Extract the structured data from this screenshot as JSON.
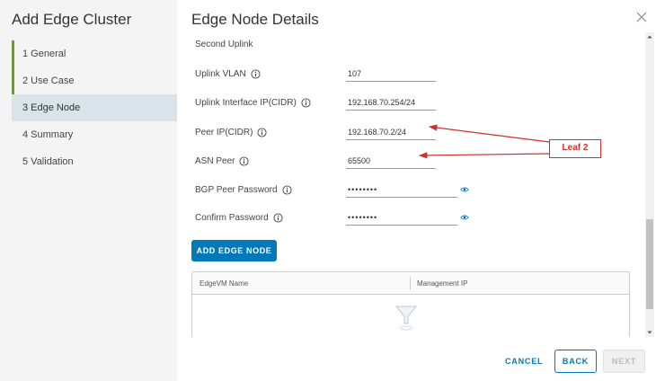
{
  "wizard": {
    "title": "Add Edge Cluster",
    "steps": [
      {
        "label": "1  General",
        "state": "done"
      },
      {
        "label": "2  Use Case",
        "state": "done"
      },
      {
        "label": "3  Edge Node",
        "state": "active"
      },
      {
        "label": "4  Summary",
        "state": "pending"
      },
      {
        "label": "5  Validation",
        "state": "pending"
      }
    ]
  },
  "main": {
    "title": "Edge Node Details",
    "section": "Second Uplink",
    "fields": {
      "uplink_vlan": {
        "label": "Uplink VLAN",
        "value": "107"
      },
      "uplink_ip": {
        "label": "Uplink Interface IP(CIDR)",
        "value": "192.168.70.254/24"
      },
      "peer_ip": {
        "label": "Peer IP(CIDR)",
        "value": "192.168.70.2/24"
      },
      "asn_peer": {
        "label": "ASN Peer",
        "value": "65500"
      },
      "bgp_password": {
        "label": "BGP Peer Password",
        "value": "••••••••"
      },
      "confirm_password": {
        "label": "Confirm Password",
        "value": "••••••••"
      }
    },
    "add_button": "ADD EDGE NODE",
    "grid": {
      "columns": [
        "EdgeVM Name",
        "Management IP"
      ]
    }
  },
  "footer": {
    "cancel": "CANCEL",
    "back": "BACK",
    "next": "NEXT"
  },
  "annotation": {
    "callout_text": "Leaf 2",
    "color": "#d0302b"
  },
  "colors": {
    "accent": "#0079b8",
    "step_done": "#62a420",
    "active_step_bg": "#d9e4ea"
  }
}
